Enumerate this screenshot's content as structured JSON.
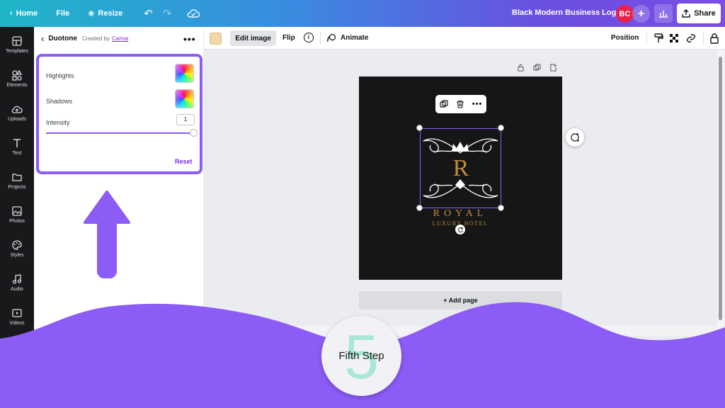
{
  "topbar": {
    "home_label": "Home",
    "file_label": "File",
    "resize_label": "Resize",
    "doc_title": "Black Modern Business Logo",
    "avatar_initials": "BC",
    "share_label": "Share"
  },
  "rail": {
    "items": [
      {
        "label": "Templates",
        "icon": "templates-icon"
      },
      {
        "label": "Elements",
        "icon": "elements-icon"
      },
      {
        "label": "Uploads",
        "icon": "uploads-icon"
      },
      {
        "label": "Text",
        "icon": "text-icon"
      },
      {
        "label": "Projects",
        "icon": "folder-icon"
      },
      {
        "label": "Photos",
        "icon": "photos-icon"
      },
      {
        "label": "Styles",
        "icon": "palette-icon"
      },
      {
        "label": "Audio",
        "icon": "music-icon"
      },
      {
        "label": "Videos",
        "icon": "video-icon"
      }
    ]
  },
  "panel": {
    "title": "Duotone",
    "created_by": "Created by",
    "creator_link": "Canva",
    "highlights_label": "Highlights",
    "shadows_label": "Shadows",
    "intensity_label": "Intensity",
    "intensity_value": "1",
    "intensity_level": 1.0,
    "reset_label": "Reset"
  },
  "context_toolbar": {
    "color": "#f1d6a8",
    "edit_image_label": "Edit image",
    "flip_label": "Flip",
    "info_glyph": "i",
    "animate_label": "Animate",
    "position_label": "Position"
  },
  "canvas": {
    "logo_letter": "R",
    "logo_title": "ROYAL",
    "logo_subtitle": "LUXURY HOTEL",
    "add_page_label": "+ Add page",
    "background": "#161616",
    "accent": "#c18b3a",
    "selection_color": "#8b5cf6"
  },
  "step": {
    "number": "5",
    "label": "Fifth Step",
    "wave_color": "#8b5cf6"
  }
}
